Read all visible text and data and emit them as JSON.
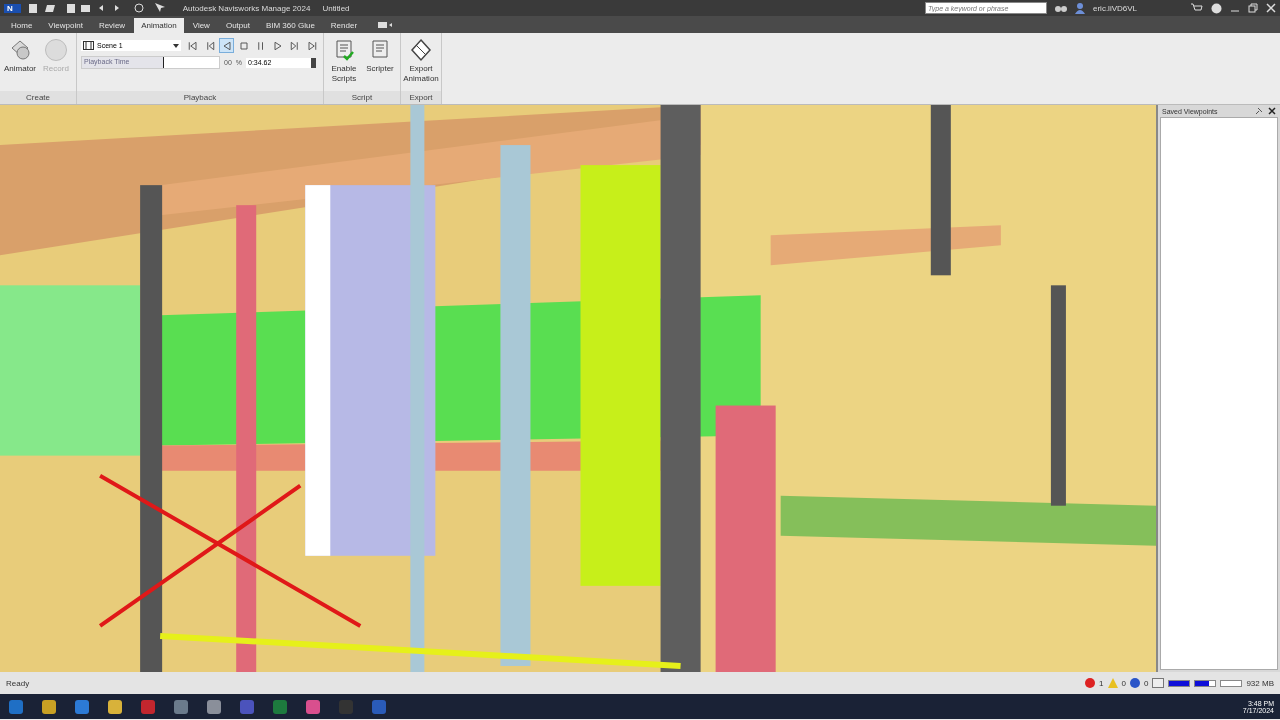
{
  "window": {
    "app_badge": "N",
    "title": "Autodesk Navisworks Manage 2024",
    "document": "Untitled"
  },
  "search": {
    "placeholder": "Type a keyword or phrase"
  },
  "user": "eric.liVD6VL",
  "tabs": [
    {
      "label": "Home",
      "selected": false
    },
    {
      "label": "Viewpoint",
      "selected": false
    },
    {
      "label": "Review",
      "selected": false
    },
    {
      "label": "Animation",
      "selected": true
    },
    {
      "label": "View",
      "selected": false
    },
    {
      "label": "Output",
      "selected": false
    },
    {
      "label": "BIM 360 Glue",
      "selected": false
    },
    {
      "label": "Render",
      "selected": false
    }
  ],
  "ribbon": {
    "create": {
      "title": "Create",
      "buttons": [
        {
          "label": "Animator",
          "kind": "animator",
          "disabled": false
        },
        {
          "label": "Record",
          "kind": "record",
          "disabled": true
        }
      ]
    },
    "playback": {
      "title": "Playback",
      "scene": "Scene 1",
      "time_label": "Playback Time",
      "level": 0.6,
      "percent": "00",
      "percent_sign": "%",
      "time": "0:34.62",
      "transport": [
        {
          "kind": "first",
          "selected": false
        },
        {
          "kind": "step-back",
          "selected": false
        },
        {
          "kind": "play-reverse",
          "selected": true
        },
        {
          "kind": "stop",
          "selected": false
        },
        {
          "kind": "pause",
          "selected": false
        },
        {
          "kind": "play",
          "selected": false
        },
        {
          "kind": "step-forward",
          "selected": false
        },
        {
          "kind": "last",
          "selected": false
        }
      ]
    },
    "script": {
      "title": "Script",
      "buttons": [
        {
          "label": "Enable Scripts",
          "kind": "enable"
        },
        {
          "label": "Scripter",
          "kind": "scripter"
        }
      ]
    },
    "export": {
      "title": "Export",
      "buttons": [
        {
          "label": "Export Animation"
        }
      ]
    }
  },
  "saved_viewpoints": {
    "title": "Saved Viewpoints"
  },
  "status_bar": {
    "text": "Ready",
    "errors": "1",
    "warnings": "0",
    "infos": "0",
    "meters": [
      {
        "level": 1
      },
      {
        "level": 0.7
      },
      {
        "level": 0
      }
    ],
    "memory": "932 MB"
  },
  "taskbar": {
    "time": "3:48 PM",
    "date": "7/17/2024"
  }
}
